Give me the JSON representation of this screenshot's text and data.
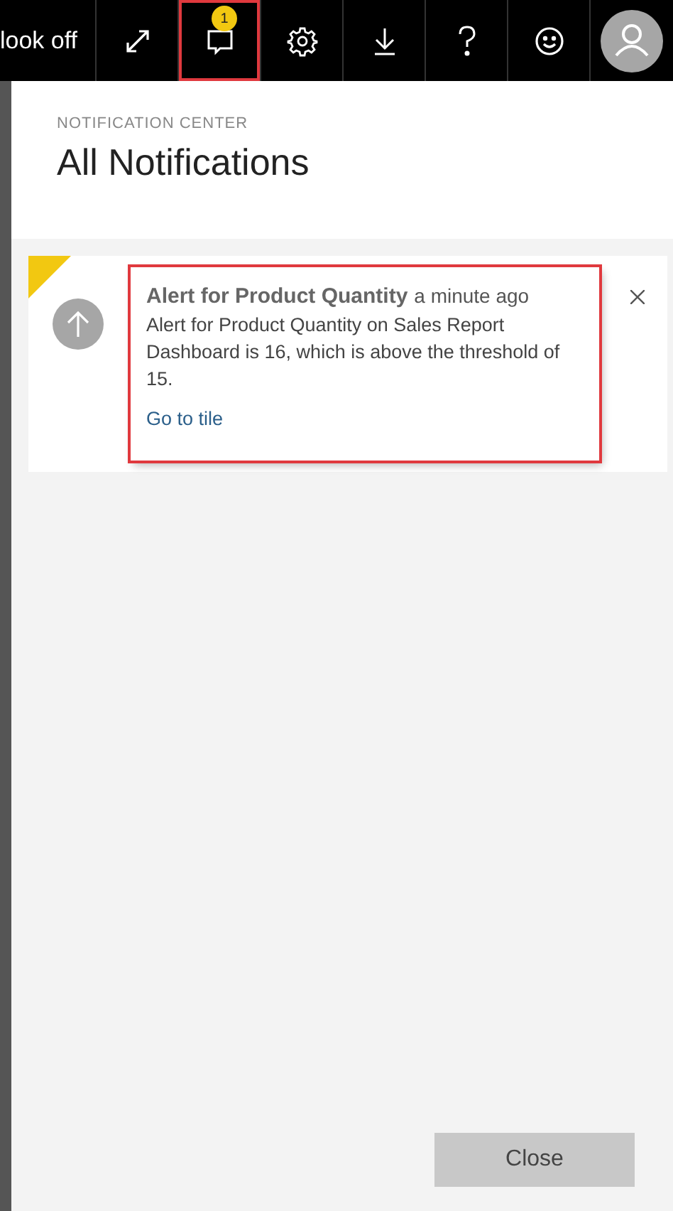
{
  "top_bar": {
    "label": "look off",
    "buttons": [
      {
        "kind": "expand",
        "selected": false
      },
      {
        "kind": "notifications",
        "selected": true,
        "badge": "1"
      },
      {
        "kind": "settings",
        "selected": false
      },
      {
        "kind": "download",
        "selected": false
      },
      {
        "kind": "help",
        "selected": false
      },
      {
        "kind": "feedback",
        "selected": false
      },
      {
        "kind": "account",
        "selected": false
      }
    ]
  },
  "panel": {
    "eyebrow": "NOTIFICATION CENTER",
    "title": "All Notifications",
    "notifications": [
      {
        "title": "Alert for Product Quantity",
        "time": "a minute ago",
        "message": "Alert for Product Quantity on Sales Report Dashboard is 16, which is above the threshold of 15.",
        "link": "Go to tile",
        "unread": true,
        "highlighted": true
      }
    ],
    "close_button": "Close"
  }
}
